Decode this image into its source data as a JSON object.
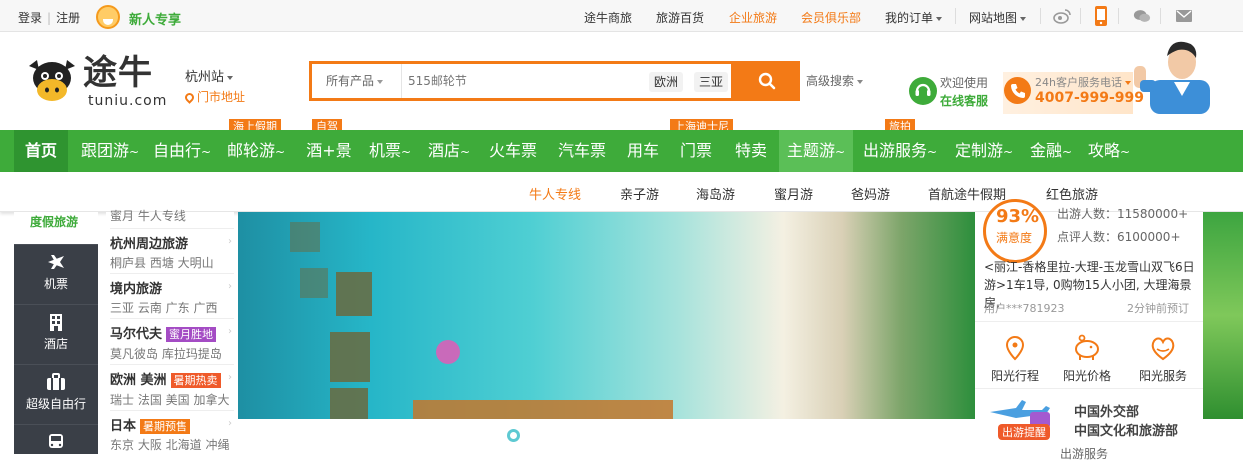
{
  "topbar": {
    "login": "登录",
    "register": "注册",
    "newbie": "新人专享",
    "links": [
      "途牛商旅",
      "旅游百货",
      "企业旅游",
      "会员俱乐部",
      "我的订单",
      "网站地图"
    ]
  },
  "header": {
    "logo_text": "途牛",
    "logo_sub": "tuniu.com",
    "city": "杭州站",
    "store": "门市地址",
    "search_category": "所有产品",
    "search_placeholder": "515邮轮节",
    "search_tags": [
      "欧洲",
      "三亚"
    ],
    "advanced_search": "高级搜索",
    "service_l1": "欢迎使用",
    "service_l2": "在线客服",
    "hotline_l1": "24h客户服务电话",
    "hotline_l2": "4007-999-999"
  },
  "nav": {
    "items": [
      "首页",
      "跟团游",
      "自由行",
      "邮轮游",
      "酒+景",
      "机票",
      "酒店",
      "火车票",
      "汽车票",
      "用车",
      "门票",
      "特卖",
      "主题游",
      "出游服务",
      "定制游",
      "金融",
      "攻略"
    ],
    "badges": [
      "海上假期",
      "自驾",
      "上海迪士尼",
      "旅拍"
    ]
  },
  "subnav": {
    "items": [
      "牛人专线",
      "亲子游",
      "海岛游",
      "蜜月游",
      "爸妈游",
      "首航途牛假期",
      "红色旅游"
    ]
  },
  "left_categories": {
    "active": "度假旅游",
    "items": [
      "机票",
      "酒店",
      "超级自由行"
    ]
  },
  "sub_categories": {
    "top_links": "蜜月  牛人专线",
    "groups": [
      {
        "title": "杭州周边旅游",
        "badge": "",
        "links": "桐庐县  西塘  大明山"
      },
      {
        "title": "境内旅游",
        "badge": "",
        "links": "三亚  云南  广东  广西"
      },
      {
        "title": "马尔代夫",
        "badge": "蜜月胜地",
        "links": "莫凡彼岛  库拉玛提岛"
      },
      {
        "title": "欧洲  美洲",
        "badge": "暑期热卖",
        "links": "瑞士  法国  美国  加拿大"
      },
      {
        "title": "日本",
        "badge": "暑期预售",
        "links": "东京  大阪  北海道  冲绳"
      }
    ]
  },
  "right_panel": {
    "satisfaction": "93%",
    "satisfaction_label": "满意度",
    "stat1": "出游人数：11580000+",
    "stat2": "点评人数：6100000+",
    "route": "<丽江-香格里拉-大理-玉龙雪山双飞6日游>1车1导, 0购物15人小团, 大理海景房,",
    "book_user": "用户***781923",
    "book_time": "2分钟前预订",
    "sun_items": [
      "阳光行程",
      "阳光价格",
      "阳光服务"
    ],
    "trip_badge": "出游提醒",
    "gov1": "中国外交部",
    "gov2": "中国文化和旅游部",
    "gov3": "出游服务"
  },
  "colors": {
    "green": "#3eab3a",
    "orange": "#f37a16",
    "dark": "#3a3f47"
  }
}
